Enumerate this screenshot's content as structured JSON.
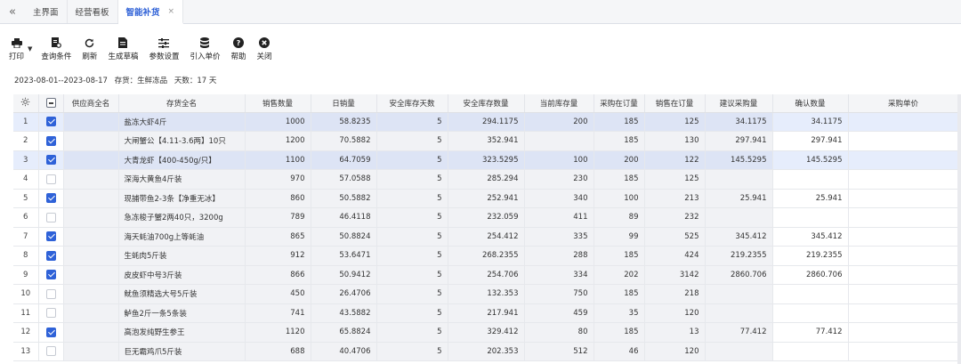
{
  "tabs": [
    {
      "label": "主界面",
      "active": false
    },
    {
      "label": "经营看板",
      "active": false
    },
    {
      "label": "智能补货",
      "active": true
    }
  ],
  "tab_close": "×",
  "toolbar": {
    "print": "打印",
    "query": "查询条件",
    "refresh": "刷新",
    "draft": "生成草稿",
    "params": "参数设置",
    "import_price": "引入单价",
    "help": "帮助",
    "close": "关闭"
  },
  "info": {
    "date_range": "2023-08-01--2023-08-17",
    "category": "存货：生鲜冻品",
    "days": "天数：17 天"
  },
  "columns": [
    "供应商全名",
    "存货全名",
    "销售数量",
    "日销量",
    "安全库存天数",
    "安全库存数量",
    "当前库存量",
    "采购在订量",
    "销售在订量",
    "建议采购量",
    "确认数量",
    "采购单价"
  ],
  "rows": [
    {
      "idx": "1",
      "checked": true,
      "selected": true,
      "supplier": "",
      "name": "盐冻大虾4斤",
      "sales": "1000",
      "daily": "58.8235",
      "safe_days": "5",
      "safe_qty": "294.1175",
      "stock": "200",
      "purchase_order": "185",
      "sales_order": "125",
      "suggest": "34.1175",
      "confirm": "34.1175",
      "price": ""
    },
    {
      "idx": "2",
      "checked": true,
      "selected": false,
      "supplier": "",
      "name": "大闸蟹公【4.11-3.6两】10只",
      "sales": "1200",
      "daily": "70.5882",
      "safe_days": "5",
      "safe_qty": "352.941",
      "stock": "",
      "purchase_order": "185",
      "sales_order": "130",
      "suggest": "297.941",
      "confirm": "297.941",
      "price": ""
    },
    {
      "idx": "3",
      "checked": true,
      "selected": true,
      "supplier": "",
      "name": "大青龙虾【400-450g/只】",
      "sales": "1100",
      "daily": "64.7059",
      "safe_days": "5",
      "safe_qty": "323.5295",
      "stock": "100",
      "purchase_order": "200",
      "sales_order": "122",
      "suggest": "145.5295",
      "confirm": "145.5295",
      "price": ""
    },
    {
      "idx": "4",
      "checked": false,
      "selected": false,
      "supplier": "",
      "name": "深海大黄鱼4斤装",
      "sales": "970",
      "daily": "57.0588",
      "safe_days": "5",
      "safe_qty": "285.294",
      "stock": "230",
      "purchase_order": "185",
      "sales_order": "125",
      "suggest": "",
      "confirm": "",
      "price": ""
    },
    {
      "idx": "5",
      "checked": true,
      "selected": false,
      "supplier": "",
      "name": "现捕带鱼2-3条【净重无冰】",
      "sales": "860",
      "daily": "50.5882",
      "safe_days": "5",
      "safe_qty": "252.941",
      "stock": "340",
      "purchase_order": "100",
      "sales_order": "213",
      "suggest": "25.941",
      "confirm": "25.941",
      "price": ""
    },
    {
      "idx": "6",
      "checked": false,
      "selected": false,
      "supplier": "",
      "name": "急冻梭子蟹2两40只，3200g",
      "sales": "789",
      "daily": "46.4118",
      "safe_days": "5",
      "safe_qty": "232.059",
      "stock": "411",
      "purchase_order": "89",
      "sales_order": "232",
      "suggest": "",
      "confirm": "",
      "price": ""
    },
    {
      "idx": "7",
      "checked": true,
      "selected": false,
      "supplier": "",
      "name": "海天蚝油700g上等蚝油",
      "sales": "865",
      "daily": "50.8824",
      "safe_days": "5",
      "safe_qty": "254.412",
      "stock": "335",
      "purchase_order": "99",
      "sales_order": "525",
      "suggest": "345.412",
      "confirm": "345.412",
      "price": ""
    },
    {
      "idx": "8",
      "checked": true,
      "selected": false,
      "supplier": "",
      "name": "生蚝肉5斤装",
      "sales": "912",
      "daily": "53.6471",
      "safe_days": "5",
      "safe_qty": "268.2355",
      "stock": "288",
      "purchase_order": "185",
      "sales_order": "424",
      "suggest": "219.2355",
      "confirm": "219.2355",
      "price": ""
    },
    {
      "idx": "9",
      "checked": true,
      "selected": false,
      "supplier": "",
      "name": "皮皮虾中号3斤装",
      "sales": "866",
      "daily": "50.9412",
      "safe_days": "5",
      "safe_qty": "254.706",
      "stock": "334",
      "purchase_order": "202",
      "sales_order": "3142",
      "suggest": "2860.706",
      "confirm": "2860.706",
      "price": ""
    },
    {
      "idx": "10",
      "checked": false,
      "selected": false,
      "supplier": "",
      "name": "鱿鱼须精选大号5斤装",
      "sales": "450",
      "daily": "26.4706",
      "safe_days": "5",
      "safe_qty": "132.353",
      "stock": "750",
      "purchase_order": "185",
      "sales_order": "218",
      "suggest": "",
      "confirm": "",
      "price": ""
    },
    {
      "idx": "11",
      "checked": false,
      "selected": false,
      "supplier": "",
      "name": "鲈鱼2斤一条5条装",
      "sales": "741",
      "daily": "43.5882",
      "safe_days": "5",
      "safe_qty": "217.941",
      "stock": "459",
      "purchase_order": "35",
      "sales_order": "120",
      "suggest": "",
      "confirm": "",
      "price": ""
    },
    {
      "idx": "12",
      "checked": true,
      "selected": false,
      "supplier": "",
      "name": "高泡发纯野生参王",
      "sales": "1120",
      "daily": "65.8824",
      "safe_days": "5",
      "safe_qty": "329.412",
      "stock": "80",
      "purchase_order": "185",
      "sales_order": "13",
      "suggest": "77.412",
      "confirm": "77.412",
      "price": ""
    },
    {
      "idx": "13",
      "checked": false,
      "selected": false,
      "supplier": "",
      "name": "巨无霸鸡爪5斤装",
      "sales": "688",
      "daily": "40.4706",
      "safe_days": "5",
      "safe_qty": "202.353",
      "stock": "512",
      "purchase_order": "46",
      "sales_order": "120",
      "suggest": "",
      "confirm": "",
      "price": ""
    }
  ]
}
